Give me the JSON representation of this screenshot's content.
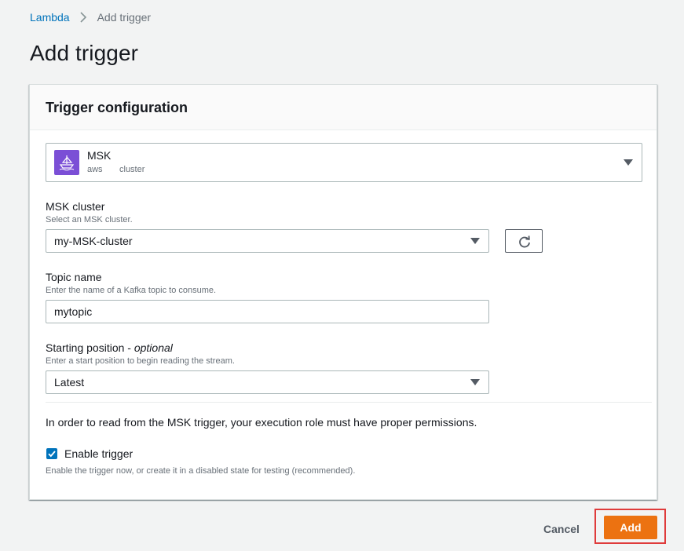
{
  "breadcrumb": {
    "parent": "Lambda",
    "current": "Add trigger"
  },
  "page": {
    "title": "Add trigger"
  },
  "panel": {
    "title": "Trigger configuration"
  },
  "source": {
    "name": "MSK",
    "tags": [
      "aws",
      "cluster"
    ],
    "icon": "msk-icon"
  },
  "msk_cluster": {
    "label": "MSK cluster",
    "description": "Select an MSK cluster.",
    "value": "my-MSK-cluster"
  },
  "topic": {
    "label": "Topic name",
    "description": "Enter the name of a Kafka topic to consume.",
    "value": "mytopic"
  },
  "starting_position": {
    "label": "Starting position - ",
    "label_suffix": "optional",
    "description": "Enter a start position to begin reading the stream.",
    "value": "Latest"
  },
  "permission_note": "In order to read from the MSK trigger, your execution role must have proper permissions.",
  "enable_trigger": {
    "label": "Enable trigger",
    "checked": true,
    "description": "Enable the trigger now, or create it in a disabled state for testing (recommended)."
  },
  "actions": {
    "cancel_label": "Cancel",
    "add_label": "Add"
  },
  "colors": {
    "primary_button": "#ec7211",
    "link": "#0073bb",
    "checkbox": "#0073bb",
    "highlight": "#df3b3b",
    "msk_icon_bg": "#7b4fd6"
  }
}
